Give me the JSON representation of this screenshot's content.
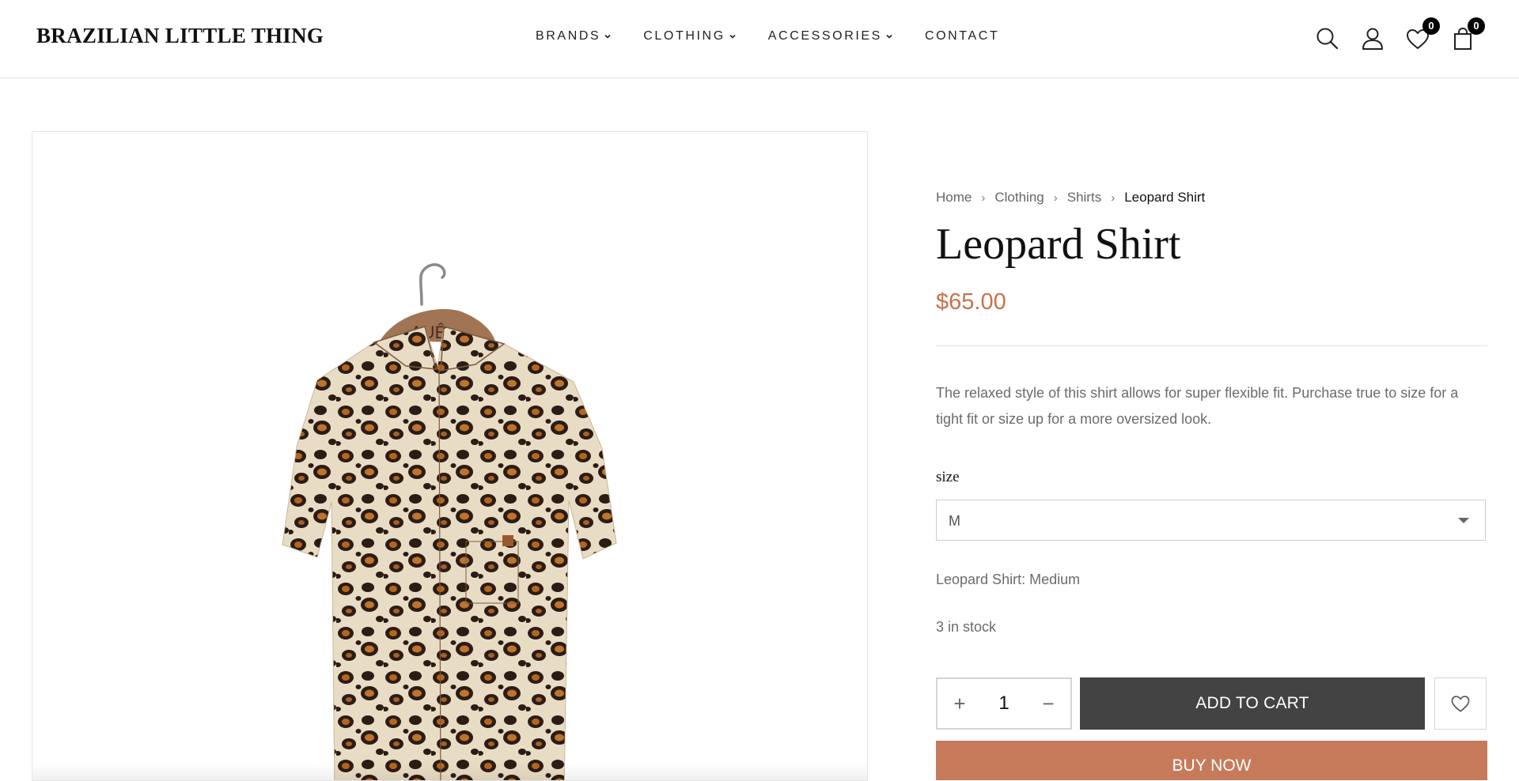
{
  "brand": {
    "logo_text": "BRAZILIAN LITTLE THING"
  },
  "nav": {
    "items": [
      {
        "label": "BRANDS",
        "has_dropdown": true
      },
      {
        "label": "CLOTHING",
        "has_dropdown": true
      },
      {
        "label": "ACCESSORIES",
        "has_dropdown": true
      },
      {
        "label": "CONTACT",
        "has_dropdown": false
      }
    ]
  },
  "header_icons": {
    "search": "search-icon",
    "account": "user-icon",
    "wishlist": {
      "icon": "heart-icon",
      "count": "0"
    },
    "cart": {
      "icon": "bag-icon",
      "count": "0"
    }
  },
  "product_image": {
    "icon": "leopard-shirt-photo",
    "hanger_text": "AUÊ"
  },
  "breadcrumb": {
    "items": [
      "Home",
      "Clothing",
      "Shirts"
    ],
    "current": "Leopard Shirt"
  },
  "product": {
    "title": "Leopard Shirt",
    "price": "$65.00",
    "description": "The relaxed style of this shirt allows for super flexible fit. Purchase true to size for a tight fit or size up for a more oversized look.",
    "size_label": "size",
    "size_selected": "M",
    "variant_text": "Leopard Shirt: Medium",
    "stock_text": "3 in stock",
    "quantity": "1"
  },
  "actions": {
    "plus_symbol": "+",
    "minus_symbol": "−",
    "add_to_cart": "ADD TO CART",
    "buy_now": "BUY NOW"
  },
  "colors": {
    "price": "#c9714b",
    "add_to_cart_bg": "#434343",
    "buy_now_bg": "#c77a5a",
    "badge_bg": "#000000"
  }
}
